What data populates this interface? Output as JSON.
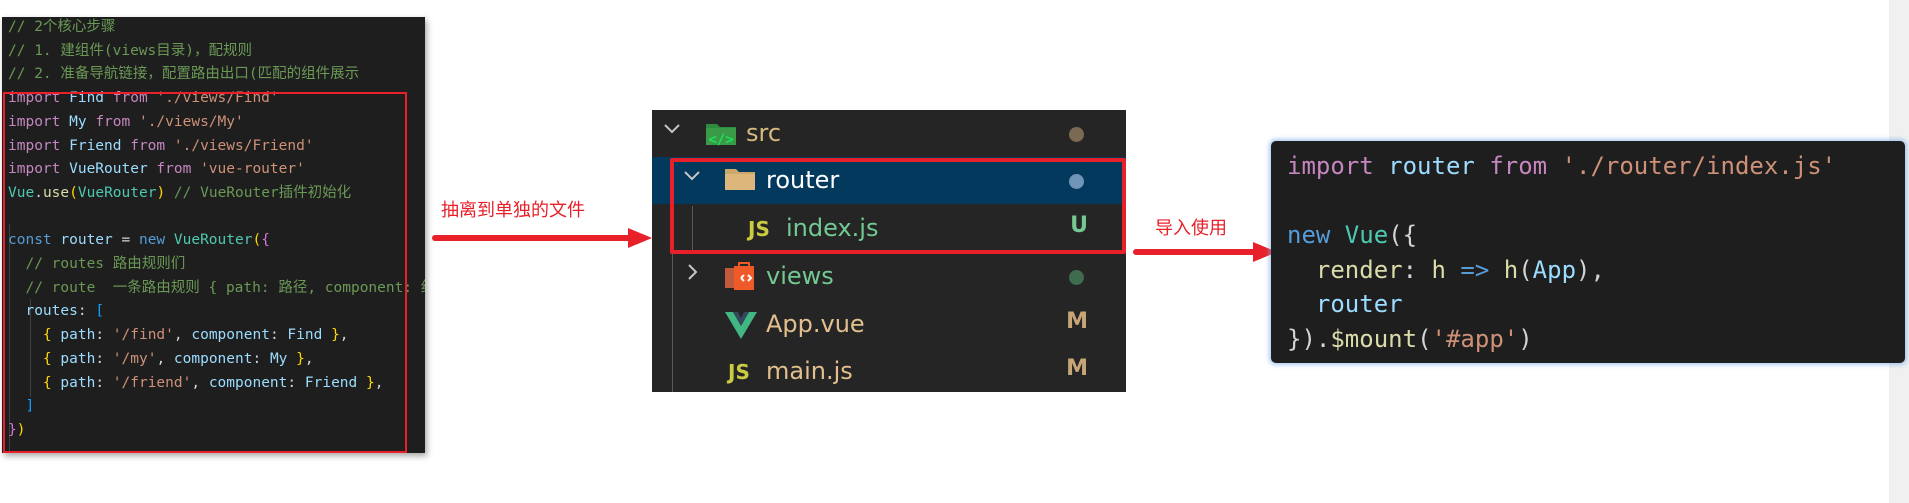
{
  "left_code": {
    "lines": [
      [
        {
          "t": "// 2个核心步骤",
          "c": "cm"
        }
      ],
      [
        {
          "t": "// 1. 建组件(views目录)，配规则",
          "c": "cm"
        }
      ],
      [
        {
          "t": "// 2. 准备导航链接，配置路由出口(匹配的组件展示",
          "c": "cm"
        }
      ],
      [
        {
          "t": "import ",
          "c": "kw"
        },
        {
          "t": "Find ",
          "c": "id"
        },
        {
          "t": "from ",
          "c": "kw"
        },
        {
          "t": "'./views/Find'",
          "c": "str"
        }
      ],
      [
        {
          "t": "import ",
          "c": "kw"
        },
        {
          "t": "My ",
          "c": "id"
        },
        {
          "t": "from ",
          "c": "kw"
        },
        {
          "t": "'./views/My'",
          "c": "str"
        }
      ],
      [
        {
          "t": "import ",
          "c": "kw"
        },
        {
          "t": "Friend ",
          "c": "id"
        },
        {
          "t": "from ",
          "c": "kw"
        },
        {
          "t": "'./views/Friend'",
          "c": "str"
        }
      ],
      [
        {
          "t": "import ",
          "c": "kw"
        },
        {
          "t": "VueRouter ",
          "c": "id"
        },
        {
          "t": "from ",
          "c": "kw"
        },
        {
          "t": "'vue-router'",
          "c": "str"
        }
      ],
      [
        {
          "t": "Vue",
          "c": "cls"
        },
        {
          "t": ".",
          "c": "op"
        },
        {
          "t": "use",
          "c": "fn"
        },
        {
          "t": "(",
          "c": "b1"
        },
        {
          "t": "VueRouter",
          "c": "cls"
        },
        {
          "t": ")",
          "c": "b1"
        },
        {
          "t": " // VueRouter插件初始化",
          "c": "cm"
        }
      ],
      [],
      [
        {
          "t": "const ",
          "c": "kb"
        },
        {
          "t": "router ",
          "c": "id"
        },
        {
          "t": "= ",
          "c": "op"
        },
        {
          "t": "new ",
          "c": "kb"
        },
        {
          "t": "VueRouter",
          "c": "cls"
        },
        {
          "t": "(",
          "c": "b1"
        },
        {
          "t": "{",
          "c": "b2"
        }
      ],
      [
        {
          "t": "  // routes 路由规则们",
          "c": "cm"
        }
      ],
      [
        {
          "t": "  // route  一条路由规则 { path: 路径, component: 组件 }",
          "c": "cm"
        }
      ],
      [
        {
          "t": "  routes",
          "c": "id"
        },
        {
          "t": ": ",
          "c": "op"
        },
        {
          "t": "[",
          "c": "b3"
        }
      ],
      [
        {
          "t": "    ",
          "c": "op"
        },
        {
          "t": "{",
          "c": "b1"
        },
        {
          "t": " path",
          "c": "id"
        },
        {
          "t": ": ",
          "c": "op"
        },
        {
          "t": "'/find'",
          "c": "str"
        },
        {
          "t": ", ",
          "c": "op"
        },
        {
          "t": "component",
          "c": "id"
        },
        {
          "t": ": ",
          "c": "op"
        },
        {
          "t": "Find ",
          "c": "id"
        },
        {
          "t": "}",
          "c": "b1"
        },
        {
          "t": ",",
          "c": "op"
        }
      ],
      [
        {
          "t": "    ",
          "c": "op"
        },
        {
          "t": "{",
          "c": "b1"
        },
        {
          "t": " path",
          "c": "id"
        },
        {
          "t": ": ",
          "c": "op"
        },
        {
          "t": "'/my'",
          "c": "str"
        },
        {
          "t": ", ",
          "c": "op"
        },
        {
          "t": "component",
          "c": "id"
        },
        {
          "t": ": ",
          "c": "op"
        },
        {
          "t": "My ",
          "c": "id"
        },
        {
          "t": "}",
          "c": "b1"
        },
        {
          "t": ",",
          "c": "op"
        }
      ],
      [
        {
          "t": "    ",
          "c": "op"
        },
        {
          "t": "{",
          "c": "b1"
        },
        {
          "t": " path",
          "c": "id"
        },
        {
          "t": ": ",
          "c": "op"
        },
        {
          "t": "'/friend'",
          "c": "str"
        },
        {
          "t": ", ",
          "c": "op"
        },
        {
          "t": "component",
          "c": "id"
        },
        {
          "t": ": ",
          "c": "op"
        },
        {
          "t": "Friend ",
          "c": "id"
        },
        {
          "t": "}",
          "c": "b1"
        },
        {
          "t": ",",
          "c": "op"
        }
      ],
      [
        {
          "t": "  ]",
          "c": "b3"
        }
      ],
      [
        {
          "t": "}",
          "c": "b2"
        },
        {
          "t": ")",
          "c": "b1"
        }
      ]
    ]
  },
  "arrow1": {
    "label": "抽离到单独的文件"
  },
  "arrow2": {
    "label": "导入使用"
  },
  "explorer": {
    "items": [
      {
        "name": "src",
        "chevron": "expanded",
        "icon": "src-folder-icon",
        "label_color": "#d7ba7d",
        "status": "dot",
        "status_color": "#7b6a52"
      },
      {
        "name": "router",
        "chevron": "expanded",
        "icon": "folder-icon",
        "label_color": "#ffffff",
        "status": "dot",
        "status_color": "#6f94b8",
        "selected": true
      },
      {
        "name": "index.js",
        "icon": "js-icon",
        "icon_text": "JS",
        "label_color": "#73c991",
        "status": "U",
        "status_color": "#73c991"
      },
      {
        "name": "views",
        "chevron": "collapsed",
        "icon": "views-folder-icon",
        "label_color": "#73c991",
        "status": "dot",
        "status_color": "#3f6b4f"
      },
      {
        "name": "App.vue",
        "icon": "vue-icon",
        "label_color": "#e2c08d",
        "status": "M",
        "status_color": "#c6a676"
      },
      {
        "name": "main.js",
        "icon": "js-icon",
        "icon_text": "JS",
        "label_color": "#e2c08d",
        "status": "M",
        "status_color": "#c6a676"
      }
    ]
  },
  "right_code": {
    "lines": [
      [
        {
          "t": "import ",
          "c": "kw"
        },
        {
          "t": "router ",
          "c": "id"
        },
        {
          "t": "from ",
          "c": "kw"
        },
        {
          "t": "'./router/index.js'",
          "c": "str"
        }
      ],
      [],
      [
        {
          "t": "new ",
          "c": "kb"
        },
        {
          "t": "Vue",
          "c": "cls"
        },
        {
          "t": "({",
          "c": "op"
        }
      ],
      [
        {
          "t": "  render",
          "c": "fn"
        },
        {
          "t": ": ",
          "c": "op"
        },
        {
          "t": "h ",
          "c": "fn"
        },
        {
          "t": "=> ",
          "c": "kb"
        },
        {
          "t": "h",
          "c": "fn"
        },
        {
          "t": "(",
          "c": "op"
        },
        {
          "t": "App",
          "c": "id"
        },
        {
          "t": "),",
          "c": "op"
        }
      ],
      [
        {
          "t": "  router",
          "c": "id"
        }
      ],
      [
        {
          "t": "})",
          "c": "op"
        },
        {
          "t": ".",
          "c": "op"
        },
        {
          "t": "$mount",
          "c": "fn"
        },
        {
          "t": "(",
          "c": "op"
        },
        {
          "t": "'#app'",
          "c": "str"
        },
        {
          "t": ")",
          "c": "op"
        }
      ]
    ]
  }
}
